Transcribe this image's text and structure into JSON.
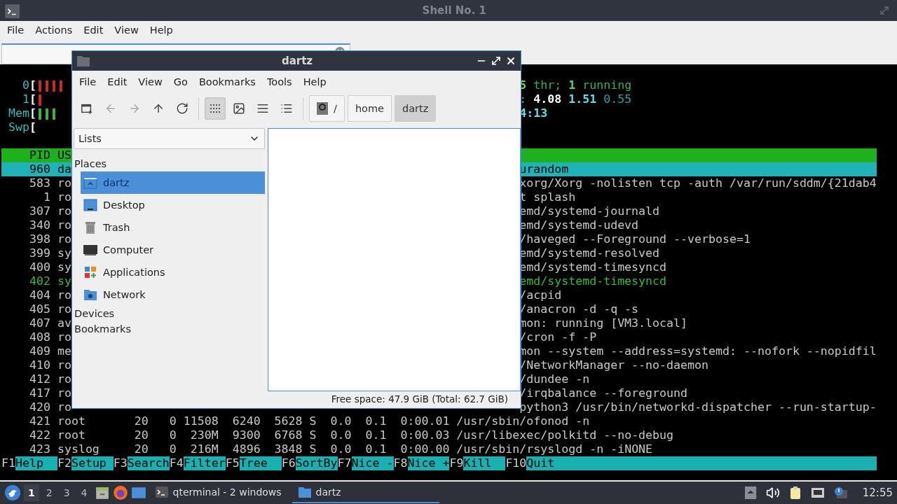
{
  "terminal_window": {
    "title": "Shell No. 1",
    "menu": [
      "File",
      "Actions",
      "Edit",
      "View",
      "Help"
    ]
  },
  "htop": {
    "meters": [
      {
        "label": "0",
        "bracket": "[",
        "bars": [
          {
            "text": "||||",
            "color": "#d02b2b"
          }
        ],
        "right": [
          {
            "text": "5",
            "color": "#5fd75f",
            "bold": true
          },
          {
            "text": " thr; ",
            "color": "#3fae5f",
            "bold": false
          },
          {
            "text": "1",
            "color": "#5fd75f",
            "bold": true
          },
          {
            "text": " running",
            "color": "#3fae5f",
            "bold": false
          }
        ]
      },
      {
        "label": "1",
        "bracket": "[",
        "bars": [
          {
            "text": "|",
            "color": "#d02b2b"
          }
        ],
        "right": [
          {
            "text": ":",
            "color": "#3fb8b8",
            "bold": false
          },
          {
            "text": " 4.08 ",
            "color": "#ffffff",
            "bold": true
          },
          {
            "text": "1.51",
            "color": "#5fe0e0",
            "bold": true
          },
          {
            "text": " 0.55",
            "color": "#2fa0a0",
            "bold": false
          }
        ]
      },
      {
        "label": "Mem",
        "bracket": "[",
        "bars": [
          {
            "text": "|||",
            "color": "#3cb83c"
          }
        ],
        "right": [
          {
            "text": "4:13",
            "color": "#5fe0e0",
            "bold": true
          }
        ]
      },
      {
        "label": "Swp",
        "bracket": "["
      }
    ],
    "header": {
      "left": "    PID US"
    },
    "processes": [
      {
        "kind": "split",
        "left": "    960 da",
        "right": "urandom",
        "selected": true,
        "thread": false
      },
      {
        "kind": "split",
        "left": "    583 ro",
        "right": "xorg/Xorg -nolisten tcp -auth /var/run/sddm/{21dab4",
        "selected": false,
        "thread": false
      },
      {
        "kind": "split",
        "left": "      1 ro",
        "right": "t splash",
        "selected": false,
        "thread": false
      },
      {
        "kind": "split",
        "left": "    307 ro",
        "right": "emd/systemd-journald",
        "selected": false,
        "thread": false
      },
      {
        "kind": "split",
        "left": "    340 ro",
        "right": "emd/systemd-udevd",
        "selected": false,
        "thread": false
      },
      {
        "kind": "split",
        "left": "    398 ro",
        "right": "/haveged --Foreground --verbose=1",
        "selected": false,
        "thread": false
      },
      {
        "kind": "split",
        "left": "    399 sy",
        "right": "emd/systemd-resolved",
        "selected": false,
        "thread": false
      },
      {
        "kind": "split",
        "left": "    400 sy",
        "right": "emd/systemd-timesyncd",
        "selected": false,
        "thread": false
      },
      {
        "kind": "split",
        "left": "    402 sy",
        "right": "emd/systemd-timesyncd",
        "selected": false,
        "thread": true
      },
      {
        "kind": "split",
        "left": "    404 ro",
        "right": "/acpid",
        "selected": false,
        "thread": false
      },
      {
        "kind": "split",
        "left": "    405 ro",
        "right": "/anacron -d -q -s",
        "selected": false,
        "thread": false
      },
      {
        "kind": "split",
        "left": "    407 av",
        "right": "mon: running [VM3.local]",
        "selected": false,
        "thread": false
      },
      {
        "kind": "split",
        "left": "    408 ro",
        "right": "/cron -f -P",
        "selected": false,
        "thread": false
      },
      {
        "kind": "split",
        "left": "    409 me",
        "right": "mon --system --address=systemd: --nofork --nopidfil",
        "selected": false,
        "thread": false
      },
      {
        "kind": "split",
        "left": "    410 ro",
        "right": "/NetworkManager --no-daemon",
        "selected": false,
        "thread": false
      },
      {
        "kind": "split",
        "left": "    412 ro",
        "right": "/dundee -n",
        "selected": false,
        "thread": false
      },
      {
        "kind": "split",
        "left": "    417 ro",
        "right": "/irqbalance --foreground",
        "selected": false,
        "thread": false
      },
      {
        "kind": "split",
        "left": "    420 ro",
        "right": "python3 /usr/bin/networkd-dispatcher --run-startup-",
        "selected": false,
        "thread": false
      },
      {
        "kind": "full",
        "text": "    421 root       20   0 11508  6240  5628 S  0.0  0.1  0:00.01 /usr/sbin/ofonod -n",
        "selected": false,
        "thread": false
      },
      {
        "kind": "full",
        "text": "    422 root       20   0  230M  9300  6768 S  0.0  0.1  0:00.03 /usr/libexec/polkitd --no-debug",
        "selected": false,
        "thread": false
      },
      {
        "kind": "full",
        "text": "    423 syslog     20   0  216M  4896  3848 S  0.0  0.1  0:00.00 /usr/sbin/rsyslogd -n -iNONE",
        "selected": false,
        "thread": false
      }
    ],
    "function_keys": [
      {
        "key": "F1",
        "label": "Help"
      },
      {
        "key": "F2",
        "label": "Setup"
      },
      {
        "key": "F3",
        "label": "Search"
      },
      {
        "key": "F4",
        "label": "Filter"
      },
      {
        "key": "F5",
        "label": "Tree"
      },
      {
        "key": "F6",
        "label": "SortBy"
      },
      {
        "key": "F7",
        "label": "Nice -"
      },
      {
        "key": "F8",
        "label": "Nice +"
      },
      {
        "key": "F9",
        "label": "Kill"
      },
      {
        "key": "F10",
        "label": "Quit"
      }
    ]
  },
  "file_manager": {
    "title": "dartz",
    "menu": [
      "File",
      "Edit",
      "View",
      "Go",
      "Bookmarks",
      "Tools",
      "Help"
    ],
    "nav_buttons": [
      {
        "kind": "new-tab",
        "disabled": false
      },
      {
        "kind": "back",
        "disabled": true
      },
      {
        "kind": "forward",
        "disabled": true
      },
      {
        "kind": "up",
        "disabled": false
      },
      {
        "kind": "reload",
        "disabled": false
      }
    ],
    "view_buttons": [
      {
        "kind": "icons",
        "selected": true
      },
      {
        "kind": "thumbnails",
        "selected": false
      },
      {
        "kind": "compact",
        "selected": false
      },
      {
        "kind": "detailed",
        "selected": false
      }
    ],
    "path": [
      {
        "kind": "root",
        "label": "/",
        "selected": false
      },
      {
        "kind": "dir",
        "label": "home",
        "selected": false
      },
      {
        "kind": "dir",
        "label": "dartz",
        "selected": true
      }
    ],
    "side_view": "Lists",
    "sections": [
      {
        "title": "Places",
        "items": [
          {
            "kind": "home",
            "label": "dartz",
            "selected": true
          },
          {
            "kind": "desktop",
            "label": "Desktop",
            "selected": false
          },
          {
            "kind": "trash",
            "label": "Trash",
            "selected": false
          },
          {
            "kind": "computer",
            "label": "Computer",
            "selected": false
          },
          {
            "kind": "applications",
            "label": "Applications",
            "selected": false
          },
          {
            "kind": "network",
            "label": "Network",
            "selected": false
          }
        ]
      },
      {
        "title": "Devices"
      },
      {
        "title": "Bookmarks"
      }
    ],
    "status": "Free space: 47.9 GiB (Total: 62.7 GiB)"
  },
  "taskbar": {
    "workspaces": [
      {
        "label": "1",
        "selected": true
      },
      {
        "label": "2",
        "selected": false
      },
      {
        "label": "3",
        "selected": false
      },
      {
        "label": "4",
        "selected": false
      }
    ],
    "tasks": [
      {
        "kind": "terminal",
        "label": "qterminal - 2 windows",
        "selected": false
      },
      {
        "kind": "folder",
        "label": "dartz",
        "selected": true
      }
    ],
    "clock": "12:55"
  }
}
